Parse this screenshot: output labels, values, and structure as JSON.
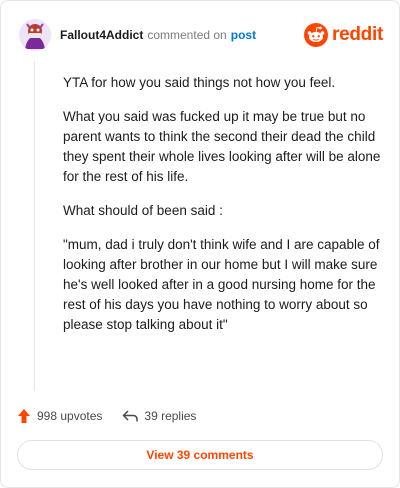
{
  "header": {
    "author": "Fallout4Addict",
    "commented_text": "commented on",
    "post_link": "post",
    "brand_name": "reddit",
    "brand_color": "#ff4500"
  },
  "comment": {
    "paragraphs": [
      "YTA for how you said things not how you feel.",
      "What you said was fucked up it may be true but no parent wants to think the second their dead the child they spent their whole lives looking after will be alone for the rest of his life.",
      "What should of been said :",
      "\"mum, dad i truly don't think wife and I are capable of looking after brother in our home but I will make sure he's well looked after in a good nursing home for the rest of his days you have nothing to worry about so please stop talking about it\""
    ]
  },
  "actions": {
    "upvotes": "998 upvotes",
    "replies": "39 replies"
  },
  "footer": {
    "view_comments": "View 39 comments"
  },
  "icons": {
    "avatar": "user-avatar-icon",
    "brand": "reddit-snoo-icon",
    "upvote": "upvote-arrow-icon",
    "reply": "reply-arrow-icon"
  }
}
